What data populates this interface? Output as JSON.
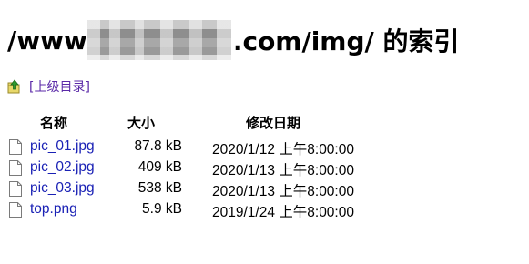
{
  "page": {
    "title_prefix": "/www",
    "title_suffix": ".com/img/ 的索引"
  },
  "parent": {
    "label": "[上级目录]"
  },
  "table": {
    "headers": {
      "name": "名称",
      "size": "大小",
      "date": "修改日期"
    },
    "rows": [
      {
        "name": "pic_01.jpg",
        "size": "87.8 kB",
        "date": "2020/1/12 上午8:00:00"
      },
      {
        "name": "pic_02.jpg",
        "size": "409 kB",
        "date": "2020/1/13 上午8:00:00"
      },
      {
        "name": "pic_03.jpg",
        "size": "538 kB",
        "date": "2020/1/13 上午8:00:00"
      },
      {
        "name": "top.png",
        "size": "5.9 kB",
        "date": "2019/1/24 上午8:00:00"
      }
    ]
  },
  "colors": {
    "link": "#1a21b5",
    "parent_link": "#5b2aa8",
    "rule": "#b8b8b8"
  },
  "icons": {
    "parent": "folder-up-icon",
    "file": "file-icon"
  }
}
